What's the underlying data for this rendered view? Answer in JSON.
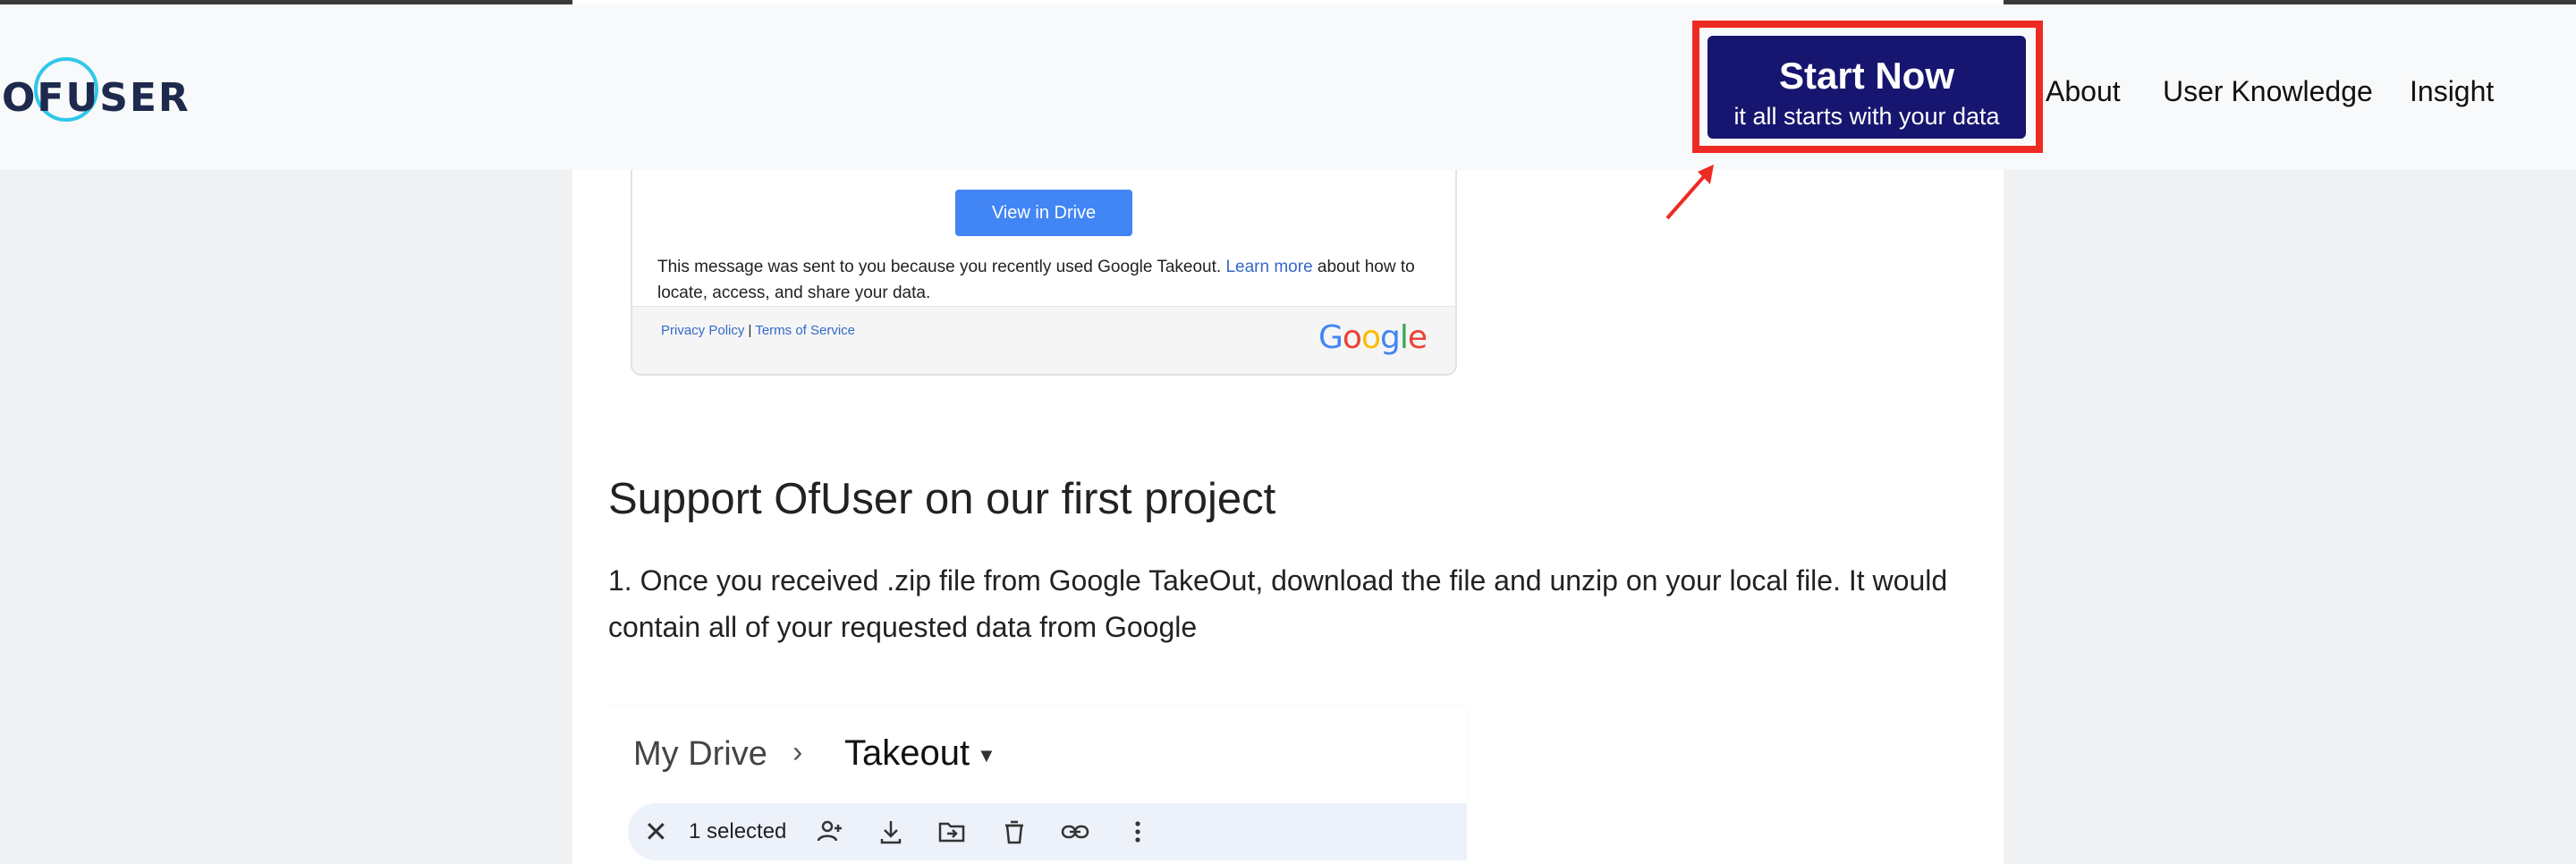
{
  "header": {
    "logo_text": "OFUSER",
    "cta_title": "Start Now",
    "cta_subtitle": "it all starts with your data",
    "nav": [
      "About",
      "User Knowledge",
      "Insight"
    ]
  },
  "email": {
    "view_button": "View in Drive",
    "message_prefix": "This message was sent to you because you recently used Google Takeout. ",
    "learn_more": "Learn more",
    "message_suffix": " about how to locate, access, and share your data.",
    "privacy_link": "Privacy Policy",
    "separator": " | ",
    "terms_link": "Terms of Service",
    "google_letters": [
      "G",
      "o",
      "o",
      "g",
      "l",
      "e"
    ]
  },
  "article": {
    "heading": "Support OfUser on our first project",
    "paragraph": "1. Once you received .zip file from Google TakeOut, download the file and unzip on your local file. It would contain all of your requested data from Google"
  },
  "drive": {
    "crumb_root": "My Drive",
    "crumb_sep": "›",
    "crumb_folder": "Takeout",
    "selected_text": "1 selected"
  },
  "colors": {
    "cta_bg": "#16156f",
    "highlight_red": "#ee2b22",
    "drive_blue": "#4285f4",
    "logo_cyan": "#2ec8ea",
    "google": [
      "#4285f4",
      "#ea4335",
      "#fbbc05",
      "#4285f4",
      "#34a853",
      "#ea4335"
    ]
  }
}
